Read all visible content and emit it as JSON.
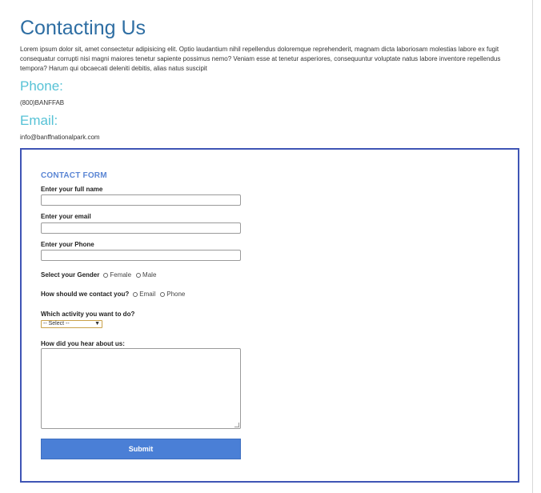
{
  "page": {
    "title": "Contacting Us",
    "intro": "Lorem ipsum dolor sit, amet consectetur adipisicing elit. Optio laudantium nihil repellendus doloremque reprehenderit, magnam dicta laboriosam molestias labore ex fugit consequatur corrupti nisi magni maiores tenetur sapiente possimus nemo? Veniam esse at tenetur asperiores, consequuntur voluptate natus labore inventore repellendus tempora? Harum qui obcaecati deleniti debitis, alias natus suscipit"
  },
  "phone": {
    "heading": "Phone:",
    "value": "(800)BANFFAB"
  },
  "email": {
    "heading": "Email:",
    "value": "info@banffnationalpark.com"
  },
  "form": {
    "title": "CONTACT FORM",
    "name_label": "Enter your full name",
    "email_label": "Enter your email",
    "phone_label": "Enter your Phone",
    "gender_label": "Select your Gender",
    "gender_options": [
      "Female",
      "Male"
    ],
    "contact_label": "How should we contact you?",
    "contact_options": [
      "Email",
      "Phone"
    ],
    "activity_label": "Which activity you want to do?",
    "activity_selected": "-- Select --",
    "hear_label": "How did you hear about us:",
    "submit_label": "Submit"
  },
  "colors": {
    "title": "#2e6ea3",
    "section_heading": "#56c2d6",
    "form_border": "#3f55b5",
    "form_title": "#5b86d4",
    "submit_bg": "#4a7fd6"
  }
}
